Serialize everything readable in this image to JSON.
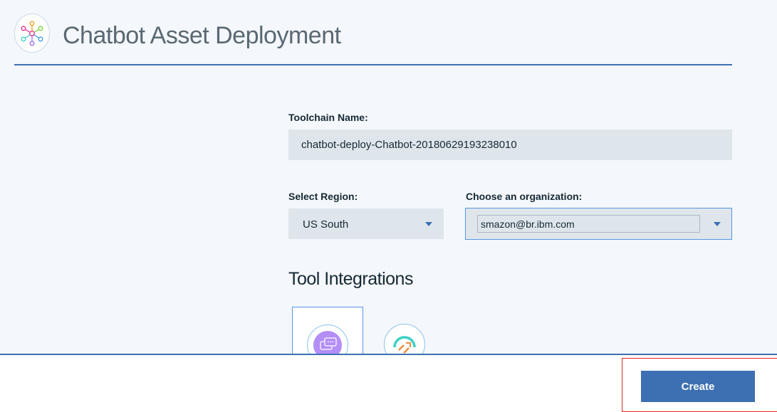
{
  "header": {
    "logo_icon": "chatbot-network-icon",
    "title": "Chatbot Asset Deployment"
  },
  "form": {
    "toolchain_label": "Toolchain Name:",
    "toolchain_value": "chatbot-deploy-Chatbot-20180629193238010",
    "region_label": "Select Region:",
    "region_value": "US South",
    "org_label": "Choose an organization:",
    "org_value": "smazon@br.ibm.com"
  },
  "tools": {
    "title": "Tool Integrations",
    "items": [
      {
        "icon": "chat-bubbles-icon",
        "selected": true
      },
      {
        "icon": "delivery-pipeline-icon",
        "selected": false
      }
    ]
  },
  "footer": {
    "create_label": "Create"
  },
  "colors": {
    "accent": "#3d70b2",
    "highlight": "#e1261c",
    "field_bg": "#dfe6eb",
    "page_bg": "#f4f7fb"
  }
}
